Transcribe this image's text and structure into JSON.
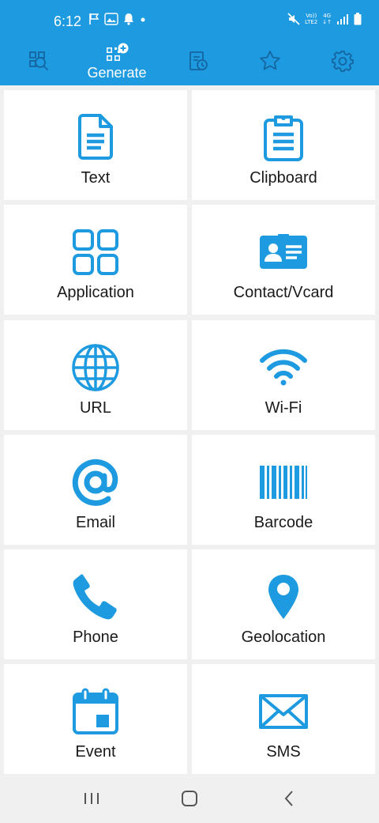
{
  "status_bar": {
    "time": "6:12",
    "left_icons": [
      "flag-icon",
      "image-icon",
      "notification-bell-icon",
      "dot-icon"
    ],
    "right_icons": [
      "mute-icon",
      "volte-icon",
      "signal-icon",
      "battery-icon"
    ],
    "volte_text": "Vo))\nLTE2",
    "network_text": "4G"
  },
  "tabs": [
    {
      "name": "scan",
      "icon": "scan-qr-icon",
      "label": ""
    },
    {
      "name": "generate",
      "icon": "generate-qr-icon",
      "label": "Generate"
    },
    {
      "name": "history",
      "icon": "history-icon",
      "label": ""
    },
    {
      "name": "favorites",
      "icon": "star-icon",
      "label": ""
    },
    {
      "name": "settings",
      "icon": "gear-icon",
      "label": ""
    }
  ],
  "items": [
    {
      "label": "Text",
      "icon": "document-icon"
    },
    {
      "label": "Clipboard",
      "icon": "clipboard-icon"
    },
    {
      "label": "Application",
      "icon": "apps-grid-icon"
    },
    {
      "label": "Contact/Vcard",
      "icon": "contact-card-icon"
    },
    {
      "label": "URL",
      "icon": "globe-icon"
    },
    {
      "label": "Wi-Fi",
      "icon": "wifi-icon"
    },
    {
      "label": "Email",
      "icon": "at-sign-icon"
    },
    {
      "label": "Barcode",
      "icon": "barcode-icon"
    },
    {
      "label": "Phone",
      "icon": "phone-icon"
    },
    {
      "label": "Geolocation",
      "icon": "location-pin-icon"
    },
    {
      "label": "Event",
      "icon": "calendar-icon"
    },
    {
      "label": "SMS",
      "icon": "envelope-icon"
    }
  ],
  "navigation": [
    "recent-apps-icon",
    "home-icon",
    "back-icon"
  ],
  "colors": {
    "accent": "#1e9ae0",
    "card_background": "#ffffff",
    "page_background": "#f0f0f0",
    "label_text": "#1a1a1a"
  }
}
